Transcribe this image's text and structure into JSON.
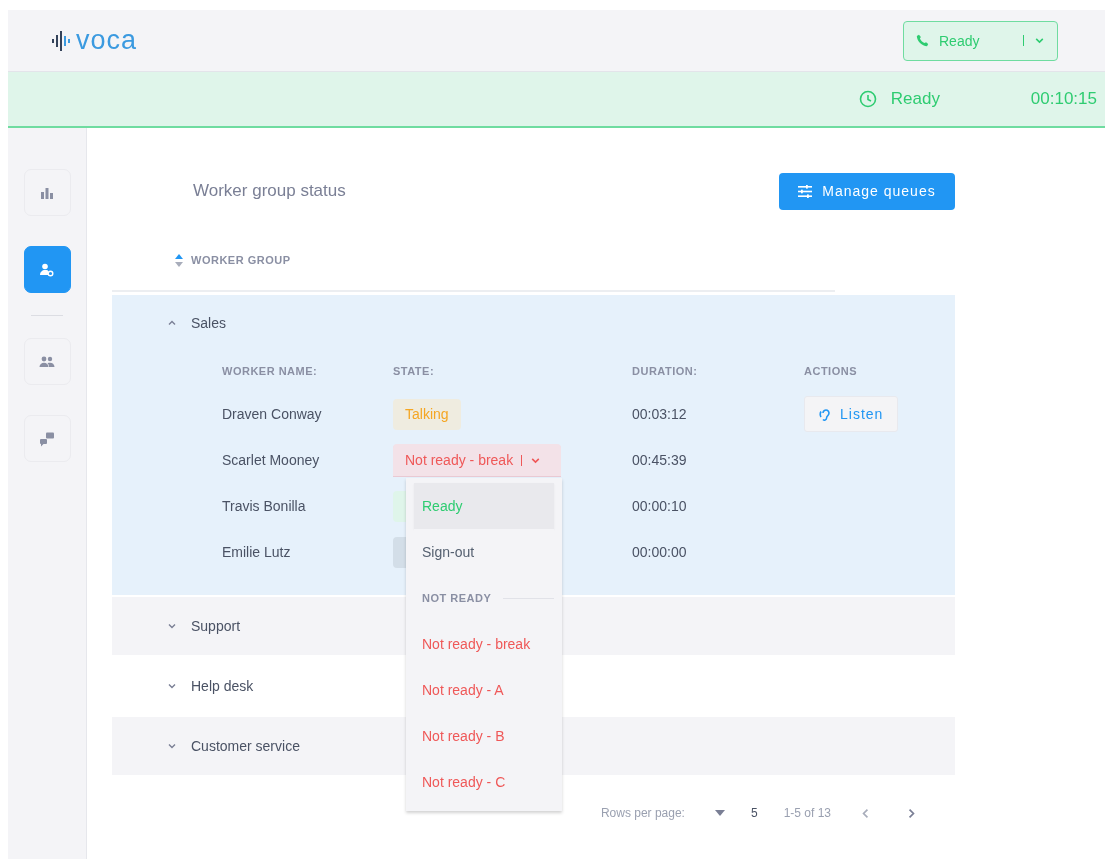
{
  "header": {
    "logo": "voca",
    "status_select": {
      "label": "Ready"
    }
  },
  "status_bar": {
    "state": "Ready",
    "timer": "00:10:15"
  },
  "sidebar": {
    "sections": [
      [
        {
          "kind": "stats",
          "selected": false
        },
        {
          "kind": "worker-settings",
          "selected": true
        }
      ],
      [
        {
          "kind": "team",
          "selected": false
        },
        {
          "kind": "messages",
          "selected": false
        }
      ]
    ]
  },
  "page": {
    "title": "Worker group status",
    "action_button": "Manage queues"
  },
  "table": {
    "sort_column": "WORKER GROUP",
    "groups": [
      {
        "name": "Sales",
        "expanded": true,
        "columns": [
          "WORKER NAME:",
          "STATE:",
          "DURATION:",
          "ACTIONS"
        ],
        "workers": [
          {
            "name": "Draven Conway",
            "state": {
              "kind": "talking",
              "label": "Talking"
            },
            "duration": "00:03:12",
            "action": "Listen"
          },
          {
            "name": "Scarlet Mooney",
            "state": {
              "kind": "not-ready",
              "label": "Not ready - break",
              "open": true
            },
            "duration": "00:45:39"
          },
          {
            "name": "Travis Bonilla",
            "state": {
              "kind": "ready"
            },
            "duration": "00:00:10"
          },
          {
            "name": "Emilie Lutz",
            "state": {
              "kind": "sign-out"
            },
            "duration": "00:00:00"
          }
        ]
      },
      {
        "name": "Support",
        "expanded": false
      },
      {
        "name": "Help desk",
        "expanded": false
      },
      {
        "name": "Customer service",
        "expanded": false
      }
    ]
  },
  "state_menu": {
    "options": [
      {
        "kind": "ready",
        "label": "Ready",
        "highlighted": true
      },
      {
        "kind": "sign-out",
        "label": "Sign-out",
        "highlighted": false
      },
      {
        "kind": "header",
        "label": "NOT READY"
      },
      {
        "kind": "not-ready",
        "label": "Not ready - break",
        "highlighted": false
      },
      {
        "kind": "not-ready",
        "label": "Not ready - A",
        "highlighted": false
      },
      {
        "kind": "not-ready",
        "label": "Not ready - B",
        "highlighted": false
      },
      {
        "kind": "not-ready",
        "label": "Not ready - C",
        "highlighted": false
      }
    ]
  },
  "pagination": {
    "rows_label": "Rows per page:",
    "rows_value": "5",
    "range": "1-5 of 13"
  }
}
